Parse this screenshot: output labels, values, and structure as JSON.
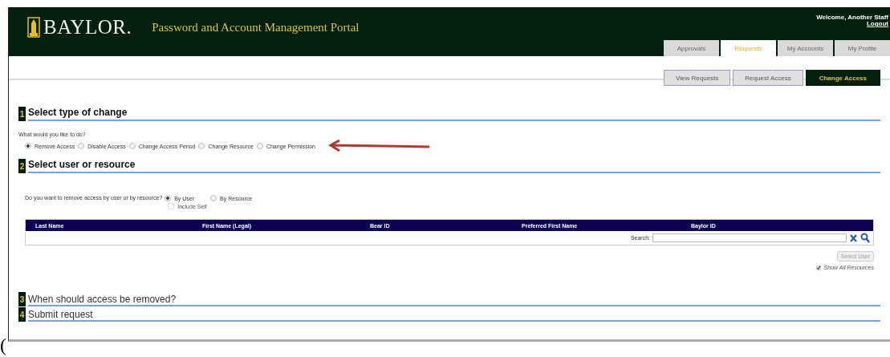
{
  "header": {
    "logo_text": "BAYLOR.",
    "title": "Password and Account Management Portal",
    "welcome": "Welcome, Another Staff",
    "logout": "Logout"
  },
  "tabs": [
    {
      "label": "Approvals",
      "selected": false
    },
    {
      "label": "Requests",
      "selected": true
    },
    {
      "label": "My Accounts",
      "selected": false
    },
    {
      "label": "My Profile",
      "selected": false
    }
  ],
  "subtabs": [
    {
      "label": "View Requests",
      "selected": false
    },
    {
      "label": "Request Access",
      "selected": false
    },
    {
      "label": "Change Access",
      "selected": true
    }
  ],
  "step1": {
    "number": "1",
    "title": "Select type of change",
    "question": "What would you like to do?",
    "options": [
      {
        "label": "Remove Access",
        "selected": true
      },
      {
        "label": "Disable Access",
        "selected": false
      },
      {
        "label": "Change Access Period",
        "selected": false
      },
      {
        "label": "Change Resource",
        "selected": false
      },
      {
        "label": "Change Permission",
        "selected": false
      }
    ]
  },
  "step2": {
    "number": "2",
    "title": "Select user or resource",
    "question": "Do you want to remove access by user or by resource?",
    "options": [
      {
        "label": "By User",
        "selected": true
      },
      {
        "label": "By Resource",
        "selected": false
      }
    ],
    "include_self": {
      "label": "Include Self",
      "checked": false,
      "disabled": true
    },
    "table": {
      "columns": [
        "Last Name",
        "First Name (Legal)",
        "Bear ID",
        "Preferred First Name",
        "Baylor ID"
      ],
      "search_label": "Search:"
    },
    "select_button": {
      "label": "Select User",
      "disabled": true
    },
    "show_all": {
      "label": "Show All Resources",
      "checked": true
    }
  },
  "step3": {
    "number": "3",
    "title": "When should access be removed?"
  },
  "step4": {
    "number": "4",
    "title": "Submit request"
  },
  "stray": "("
}
